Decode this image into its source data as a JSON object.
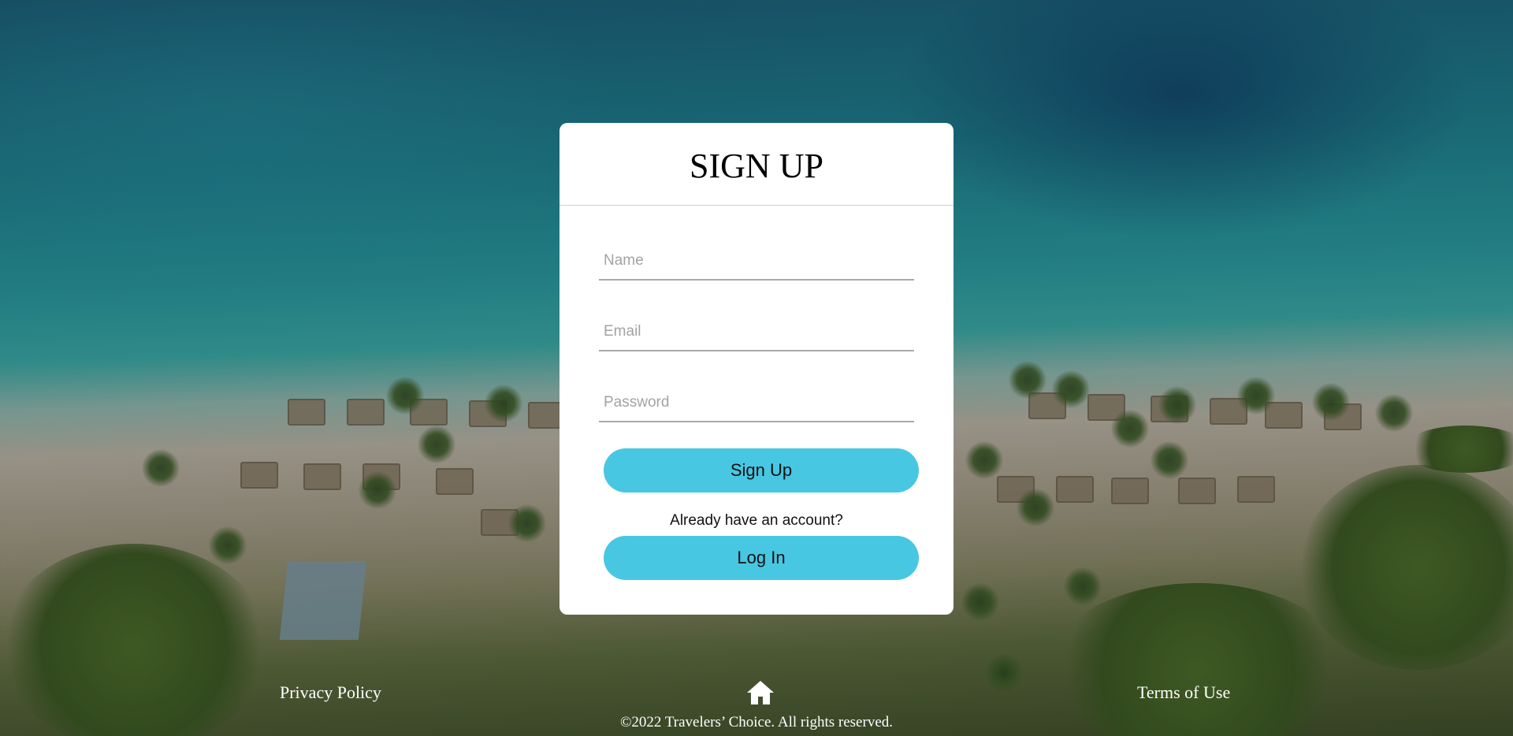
{
  "signup": {
    "title": "SIGN UP",
    "name_placeholder": "Name",
    "email_placeholder": "Email",
    "password_placeholder": "Password",
    "signup_button": "Sign Up",
    "already_text": "Already have an account?",
    "login_button": "Log In"
  },
  "footer": {
    "privacy": "Privacy Policy",
    "terms": "Terms of Use",
    "home_icon": "home-icon",
    "copyright": "©2022 Travelers’ Choice. All rights reserved."
  },
  "colors": {
    "button": "#48c7e2",
    "card": "#ffffff"
  }
}
